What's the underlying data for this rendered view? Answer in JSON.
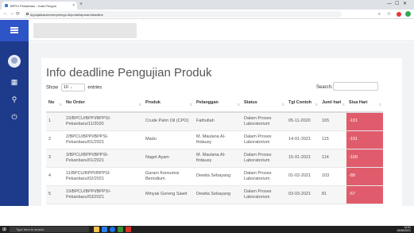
{
  "browser": {
    "tab_title": "BPPU Pekanbaru - Kata Pengun",
    "tab_close": "×",
    "new_tab": "+",
    "url": "bppujakkankemenperingo.id/portal/laporan/deadline",
    "window_controls": [
      "—",
      "☐",
      "✕"
    ],
    "nav": {
      "back": "←",
      "forward": "→",
      "reload": "⟳"
    },
    "right_icons": "⌕ ☆"
  },
  "sidebar": {
    "icons": [
      "menu-icon",
      "avatar",
      "grid-icon",
      "location-icon",
      "power-icon"
    ],
    "glyphs": {
      "grid": "▦",
      "location": "⚲",
      "power": "⏻"
    },
    "colors": {
      "bg": "#1e3a8a",
      "toggle": "#2e55c7"
    }
  },
  "page": {
    "title": "Info deadline Pengujian Produk",
    "show_label": "Show",
    "entries_value": "10",
    "entries_label": "entries",
    "search_label": "Search:"
  },
  "table": {
    "headers": [
      "No",
      "No Order",
      "Produk",
      "Pelanggan",
      "Status",
      "Tgl Contoh",
      "Juml hari",
      "Sisa Hari"
    ],
    "rows": [
      [
        "1",
        "23/BPCU/BPPI/BPPSI-Pekanbaru/11/2020",
        "Crude Palm Oil (CPO)",
        "Fathullah",
        "Dalam Proses Laboratorium",
        "05-11-2020",
        "165",
        "-101"
      ],
      [
        "2",
        "2/BPCU/BPPI/BPPSI-Pekanbaru/01/2021",
        "Madu",
        "M. Maulana Al-firdausy",
        "Dalam Proses Laboratorium",
        "14-01-2021",
        "115",
        "-101"
      ],
      [
        "3",
        "3/BPCU/BPPI/BPPSI-Pekanbaru/01/2021",
        "Naget Ayam",
        "M. Maulana Al-firdausy",
        "Dalam Proses Laboratorium",
        "15-01-2021",
        "114",
        "-100"
      ],
      [
        "4",
        "11/BPCU/BPPI/BPPSI-Pekanbaru/02/2021",
        "Garam Konsumsi Beriodium",
        "Dewita Sebayang",
        "Dalam Proses Laboratorium",
        "01-02-2021",
        "103",
        "-89"
      ],
      [
        "5",
        "19/BPCU/BPPI/BPPSI-Pekanbaru/03/2021",
        "Minyak Goreng Sawit",
        "Dewita Sebayang",
        "Dalam Proses Laboratorium",
        "03-03-2021",
        "81",
        "-67"
      ]
    ],
    "colors": {
      "overdue": "#e05c6c"
    }
  },
  "taskbar": {
    "start": "⊞",
    "search_placeholder": "Type here to search",
    "tray_time": "14:01",
    "tray_date": "03/06/2021"
  }
}
